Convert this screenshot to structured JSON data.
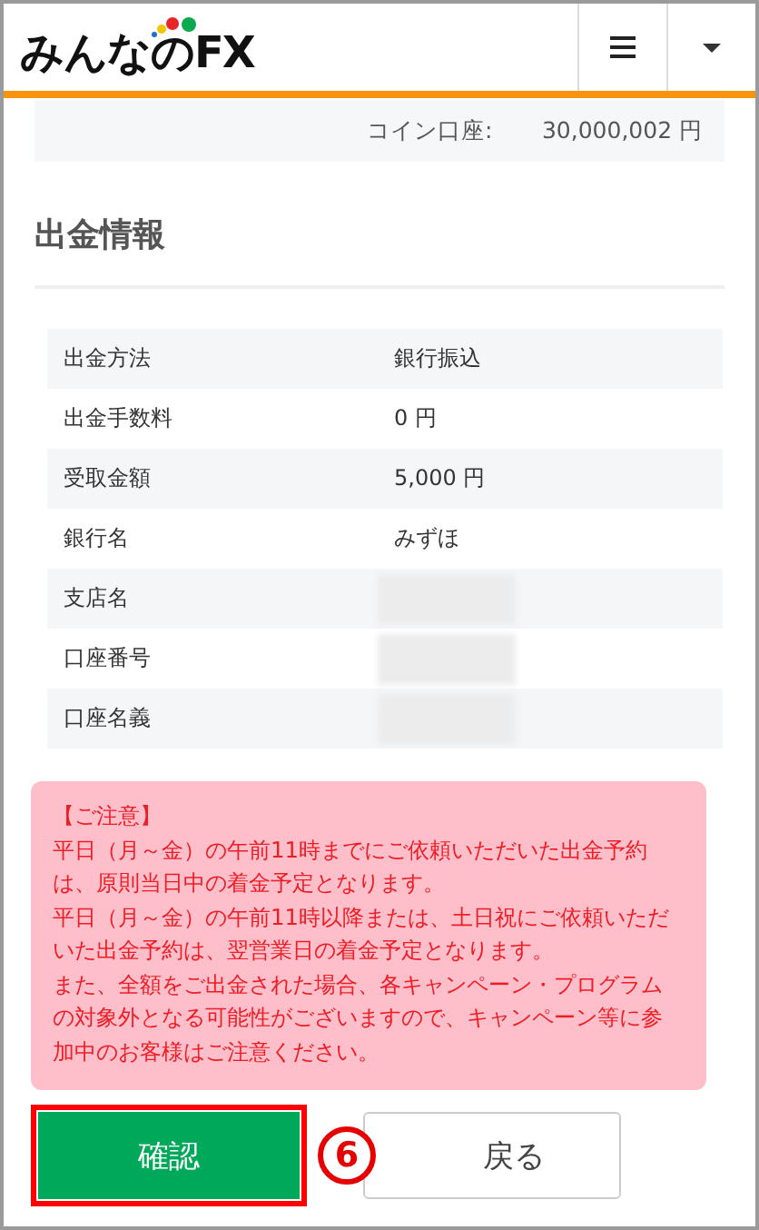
{
  "header": {
    "logo": "みんなのFX"
  },
  "balance": {
    "label": "コイン口座:",
    "value": "30,000,002 円"
  },
  "section": {
    "title": "出金情報"
  },
  "rows": [
    {
      "label": "出金方法",
      "kind": "text",
      "value": "銀行振込"
    },
    {
      "label": "出金手数料",
      "kind": "text",
      "value": "0 円"
    },
    {
      "label": "受取金額",
      "kind": "text",
      "value": "5,000 円"
    },
    {
      "label": "銀行名",
      "kind": "text",
      "value": "みずほ"
    },
    {
      "label": "支店名",
      "kind": "redacted"
    },
    {
      "label": "口座番号",
      "kind": "redacted"
    },
    {
      "label": "口座名義",
      "kind": "redacted"
    }
  ],
  "notice": [
    "【ご注意】",
    "平日（月～金）の午前11時までにご依頼いただいた出金予約は、原則当日中の着金予定となります。",
    "平日（月～金）の午前11時以降または、土日祝にご依頼いただいた出金予約は、翌営業日の着金予定となります。",
    "また、全額をご出金された場合、各キャンペーン・プログラムの対象外となる可能性がございますので、キャンペーン等に参加中のお客様はご注意ください。"
  ],
  "buttons": {
    "confirm": {
      "label": "確認",
      "highlighted": true
    },
    "marker": "6",
    "back": {
      "label": "戻る"
    }
  }
}
